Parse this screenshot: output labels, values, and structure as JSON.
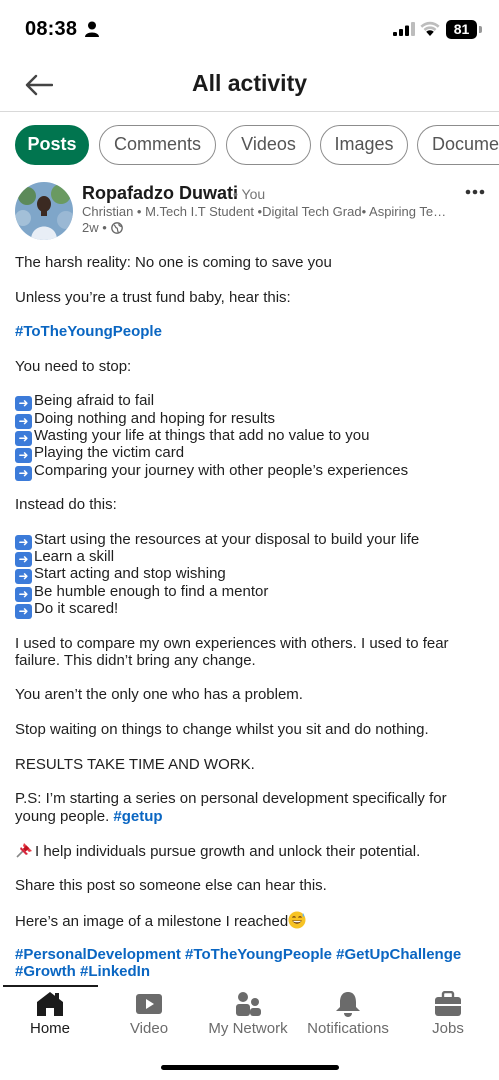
{
  "status_bar": {
    "time": "08:38",
    "battery": "81",
    "icons": [
      "person-icon",
      "signal-icon",
      "wifi-icon",
      "battery-icon"
    ]
  },
  "header": {
    "title": "All activity",
    "back_icon": "arrow-left-icon"
  },
  "filters": [
    {
      "label": "Posts",
      "active": true
    },
    {
      "label": "Comments",
      "active": false
    },
    {
      "label": "Videos",
      "active": false
    },
    {
      "label": "Images",
      "active": false
    },
    {
      "label": "Documents",
      "active": false
    }
  ],
  "post": {
    "author": "Ropafadzo Duwati",
    "you_label": "• You",
    "headline": "Christian • M.Tech I.T Student •Digital Tech Grad• Aspiring Tech Leader",
    "time_ago": "2w •",
    "visibility_icon": "globe-icon",
    "more_icon": "more-horizontal-icon",
    "lines": [
      "The harsh reality: No one is coming to save you",
      "Unless you’re a trust fund baby, hear this:",
      "#ToTheYoungPeople",
      "You need to stop:",
      "Being afraid to fail",
      "Doing nothing and hoping for results",
      "Wasting your life at things that add no value to you",
      "Playing the victim card",
      "Comparing your journey with other people’s experiences",
      "Instead do this:",
      "Start using the resources at your disposal to build your life",
      "Learn a skill",
      "Start acting and stop wishing",
      "Be humble enough to find a mentor",
      "Do it scared!",
      "I used to compare my own experiences with others. I used to fear",
      "failure. This didn’t bring any change.",
      "You aren’t the only one who has a problem.",
      "Stop waiting on things to change whilst you sit and do nothing.",
      "RESULTS TAKE TIME AND WORK.",
      "P.S: I’m starting a series on personal development specifically for",
      "young people.",
      "#getup",
      "I help individuals pursue growth and unlock their potential.",
      "Share this post so someone else can hear this.",
      "Here’s an image of a milestone I reached",
      "#PersonalDevelopment #ToTheYoungPeople #GetUpChallenge",
      "#Growth #LinkedIn"
    ]
  },
  "bottom_nav": [
    {
      "label": "Home",
      "icon": "home-icon",
      "active": true
    },
    {
      "label": "Video",
      "icon": "video-icon",
      "active": false
    },
    {
      "label": "My Network",
      "icon": "network-icon",
      "active": false
    },
    {
      "label": "Notifications",
      "icon": "bell-icon",
      "active": false
    },
    {
      "label": "Jobs",
      "icon": "briefcase-icon",
      "active": false
    }
  ],
  "colors": {
    "accent_green": "#01754f",
    "link_blue": "#0a66c2"
  }
}
